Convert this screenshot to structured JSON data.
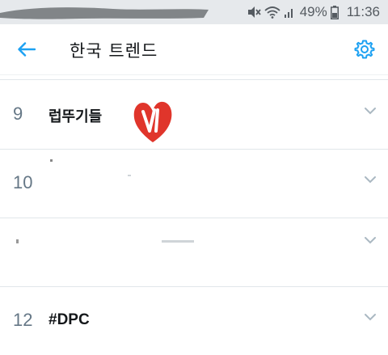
{
  "status_bar": {
    "battery_percent": "49%",
    "time": "11:36",
    "icons": [
      "mute-icon",
      "wifi-icon",
      "signal-icon",
      "battery-icon"
    ]
  },
  "header": {
    "back_icon": "arrow-left-icon",
    "title": "한국 트렌드",
    "settings_icon": "gear-icon"
  },
  "trends": [
    {
      "rank": "9",
      "name": "럽뚜기들"
    },
    {
      "rank": "10",
      "name": ""
    },
    {
      "rank": "",
      "name": ""
    },
    {
      "rank": "12",
      "name": "#DPC"
    }
  ],
  "colors": {
    "accent": "#1da1f2",
    "rank_text": "#657786",
    "divider": "#e1e6ea",
    "heart": "#e0352b"
  }
}
